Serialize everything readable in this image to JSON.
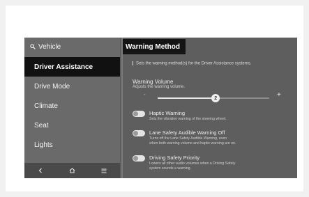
{
  "sidebar": {
    "back_label": "Vehicle",
    "items": [
      {
        "label": "Driver Assistance",
        "active": true
      },
      {
        "label": "Drive Mode",
        "active": false
      },
      {
        "label": "Climate",
        "active": false
      },
      {
        "label": "Seat",
        "active": false
      },
      {
        "label": "Lights",
        "active": false
      }
    ],
    "bottom_icons": [
      "back-arrow-icon",
      "home-icon",
      "menu-icon"
    ]
  },
  "content": {
    "title": "Warning Method",
    "info": "Sets the warning method(s) for the Driver Assistance systems.",
    "volume": {
      "title": "Warning Volume",
      "subtitle": "Adjusts the warning volume.",
      "value": "2",
      "level_fraction": 0.52,
      "minus": "-",
      "plus": "+"
    },
    "options": [
      {
        "title": "Haptic Warning",
        "desc": [
          "Sets the vibration warning of the steering wheel."
        ]
      },
      {
        "title": "Lane Safety Audible Warning Off",
        "desc": [
          "Turns off the Lane Safety Audible Warning, even",
          "when both warning volume and haptic warning are on."
        ]
      },
      {
        "title": "Driving Safety Priority",
        "desc": [
          "Lowers all other audio volumes when a Driving Safety",
          "system sounds a warning."
        ]
      }
    ]
  },
  "colors": {
    "screen_bg": "#5e5e5e",
    "active_bg": "#111111",
    "text": "#f2f2f2"
  }
}
